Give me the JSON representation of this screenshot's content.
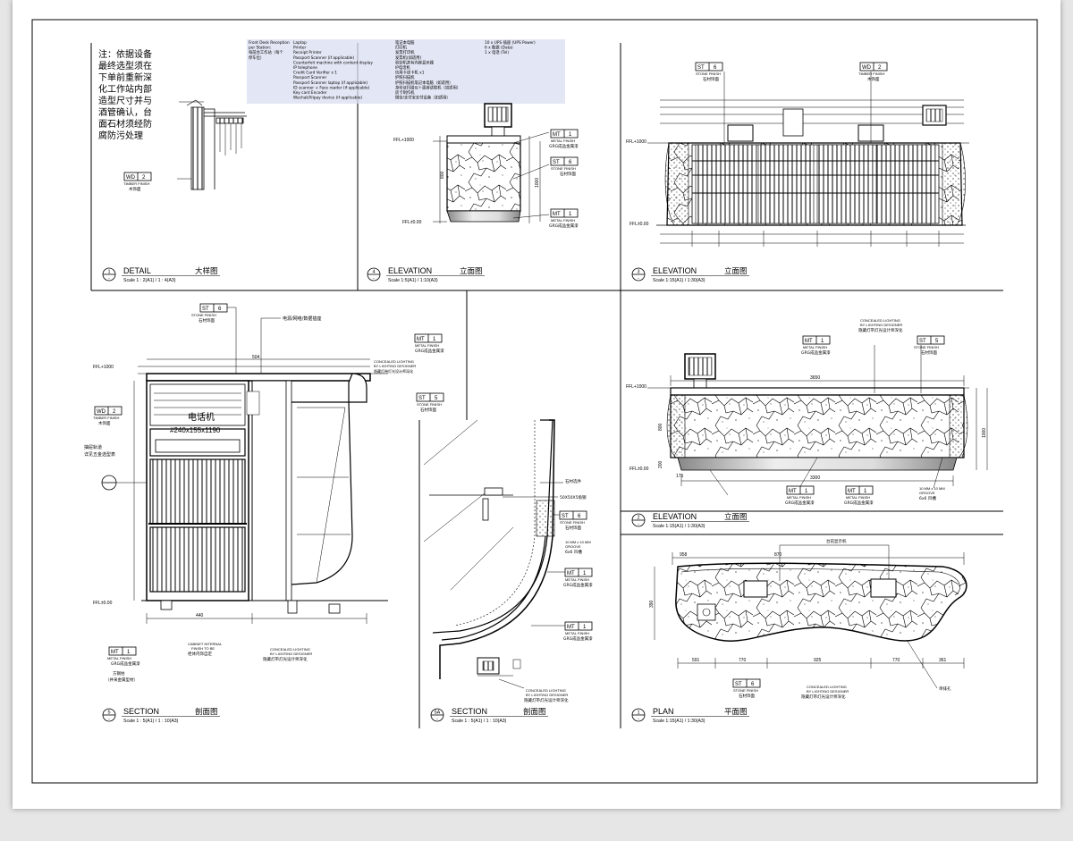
{
  "note": {
    "lines": [
      "注：依据设备",
      "最终选型须在",
      "下单前重新深",
      "化工作站内部",
      "造型尺寸并与",
      "酒管确认，台",
      "面石材须经防",
      "腐防污处理"
    ]
  },
  "equipment": {
    "c1": [
      "Front Desk Reception",
      "per Station:",
      "每前台工作站（每个",
      "停车位）"
    ],
    "c2": [
      "Laptop",
      "Printer",
      "Receipt Printer",
      "Passport Scanner (if applicable)",
      "Counterfeit machine with content display",
      "IP telephone",
      "Credit Card Verifier x 1",
      "Passport Scanner",
      "Passport Scanner laptop (if applicable)",
      "ID scanner + Face reader (if applicable)",
      "Key card Encoder",
      "Wechat/Alipay device (if applicable)"
    ],
    "c3": [
      "笔记本电脑",
      "打印机",
      "发票打印机",
      "发票机(如适用)",
      "验钞机并有内容显示器",
      "IP电话机",
      "信用卡读卡机 x1",
      "护照扫描机",
      "护照扫描机笔记本电脑（如适用）",
      "身份证扫描仪＋面容读取机（如适用）",
      "房卡制作机",
      "微信/支付宝支付设备（如适用）"
    ],
    "c4": [
      "10 x UPS 插座 (UPS Power)",
      "6 x 数据 (Data)",
      "1 x 电话 (Tel)"
    ]
  },
  "panels": [
    {
      "num": "1",
      "title": "DETAIL",
      "cn": "大样图",
      "scale": "Scale 1 : 2(A1) / 1 : 4(A3)"
    },
    {
      "num": "4",
      "title": "ELEVATION",
      "cn": "立面图",
      "scale": "Scale 1:5(A1) / 1:10(A3)"
    },
    {
      "num": "3",
      "title": "ELEVATION",
      "cn": "立面图",
      "scale": "Scale 1:15(A1) / 1:30(A3)"
    },
    {
      "num": "2",
      "title": "ELEVATION",
      "cn": "立面图",
      "scale": "Scale 1:15(A1) / 1:30(A3)"
    },
    {
      "num": "5",
      "title": "SECTION",
      "cn": "剖面图",
      "scale": "Scale 1 : 5(A1) / 1 : 10(A3)"
    },
    {
      "num": "5A",
      "title": "SECTION",
      "cn": "剖面图",
      "scale": "Scale 1 : 5(A1) / 1 : 10(A3)"
    },
    {
      "num": "1",
      "title": "PLAN",
      "cn": "平面图",
      "scale": "Scale 1:15(A1) / 1:30(A3)"
    }
  ],
  "tags": {
    "wd2": {
      "code": "WD",
      "no": "2",
      "label": "TIMBER FINISH",
      "cn": "木饰面"
    },
    "st6": {
      "code": "ST",
      "no": "6",
      "label": "STONE FINISH",
      "cn": "石材饰面"
    },
    "mt1": {
      "code": "MT",
      "no": "1",
      "label": "METAL FINISH",
      "cn": "GRG成品金属漆"
    },
    "st5": {
      "code": "ST",
      "no": "5",
      "label": "STONE FINISH",
      "cn": "石材饰面"
    }
  },
  "labels": {
    "ffl1000": "FFL+1000",
    "ffl0": "FFL±0.00",
    "concealed_lighting": "CONCEALED LIGHTING",
    "by_lighting_designer": "BY LIGHTING DESIGNER",
    "lighting_cn": "隐藏灯带灯光设计师深化",
    "power_cn": "电源/网络/数据插座",
    "cabinet_cn": "电话机",
    "cabinet_size": "#240x155x1190",
    "rail_cn": [
      "抽屉轨道",
      "详见五金选型表"
    ],
    "groove": "10 MM x 10 MM",
    "groove2": "GROOVE",
    "groove_cn": "6x6 凹槽",
    "cabinet_internal": [
      "CABINET INTERNAL",
      "FINISH TO BE",
      "柜体内饰自定"
    ],
    "stone_cn": "石材选件",
    "bolt_cn": "50X50X5角钢",
    "tv_cn": "台前显示机",
    "sink_cn": "单排孔",
    "bottom_cn": [
      "方钢柱",
      "（并采金属型材）"
    ]
  },
  "dims": {
    "d3650": "3650",
    "d3300": "3300",
    "d800": "800",
    "d1000": "1000",
    "d200": "200",
    "d175": "175",
    "p591": "591",
    "p770": "770",
    "p925": "925",
    "p361": "361",
    "p958": "958",
    "p870": "870",
    "p390": "390",
    "s504": "504",
    "s440": "440"
  }
}
